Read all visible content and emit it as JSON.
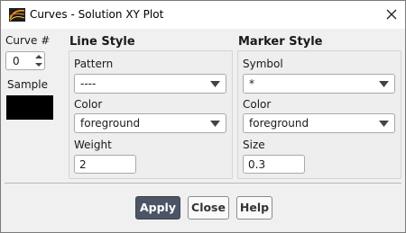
{
  "window": {
    "title": "Curves - Solution XY Plot"
  },
  "curve": {
    "label": "Curve #",
    "value": "0",
    "sample_label": "Sample",
    "sample_color": "#000000"
  },
  "line_style": {
    "title": "Line Style",
    "pattern_label": "Pattern",
    "pattern_value": "----",
    "color_label": "Color",
    "color_value": "foreground",
    "weight_label": "Weight",
    "weight_value": "2"
  },
  "marker_style": {
    "title": "Marker Style",
    "symbol_label": "Symbol",
    "symbol_value": "*",
    "color_label": "Color",
    "color_value": "foreground",
    "size_label": "Size",
    "size_value": "0.3"
  },
  "buttons": {
    "apply": "Apply",
    "close": "Close",
    "help": "Help"
  },
  "colors": {
    "primary_button": "#4b5565",
    "background": "#f0f0f0"
  }
}
